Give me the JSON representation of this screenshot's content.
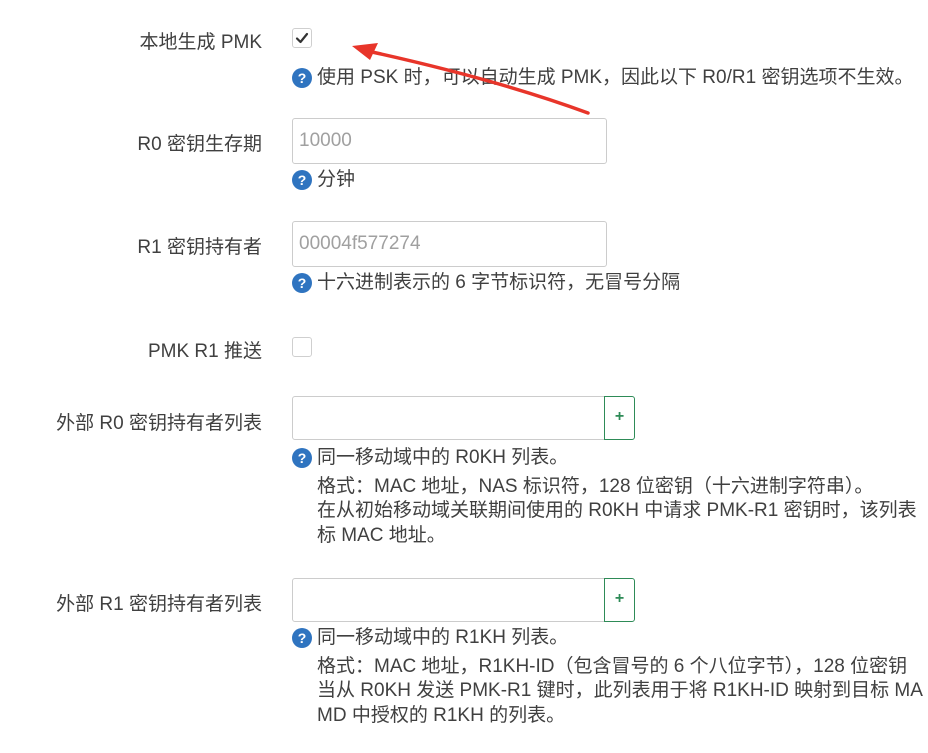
{
  "rows": {
    "local_pmk": {
      "label": "本地生成 PMK",
      "checked": true,
      "help": [
        "使用 PSK 时，可以自动生成 PMK，因此以下 R0/R1 密钥选项不生效。"
      ]
    },
    "r0_lifetime": {
      "label": "R0 密钥生存期",
      "placeholder": "10000",
      "help": [
        "分钟"
      ]
    },
    "r1_holder": {
      "label": "R1 密钥持有者",
      "placeholder": "00004f577274",
      "help": [
        "十六进制表示的 6 字节标识符，无冒号分隔"
      ]
    },
    "pmk_r1_push": {
      "label": "PMK R1 推送",
      "checked": false
    },
    "r0kh_list": {
      "label": "外部 R0 密钥持有者列表",
      "add_label": "+",
      "help": [
        "同一移动域中的 R0KH 列表。",
        "格式：MAC 地址，NAS 标识符，128 位密钥（十六进制字符串）。",
        "在从初始移动域关联期间使用的 R0KH 中请求 PMK-R1 密钥时，该列表",
        "标 MAC 地址。"
      ]
    },
    "r1kh_list": {
      "label": "外部 R1 密钥持有者列表",
      "add_label": "+",
      "help": [
        "同一移动域中的 R1KH 列表。",
        "格式：MAC 地址，R1KH-ID（包含冒号的 6 个八位字节），128 位密钥",
        "当从 R0KH 发送 PMK-R1 键时，此列表用于将 R1KH-ID 映射到目标 MA",
        "MD 中授权的 R1KH 的列表。"
      ]
    }
  },
  "help_icon_glyph": "?",
  "colors": {
    "annotation_arrow": "#e8352a",
    "help_icon": "#2f74c0",
    "add_button": "#2e8b57"
  }
}
